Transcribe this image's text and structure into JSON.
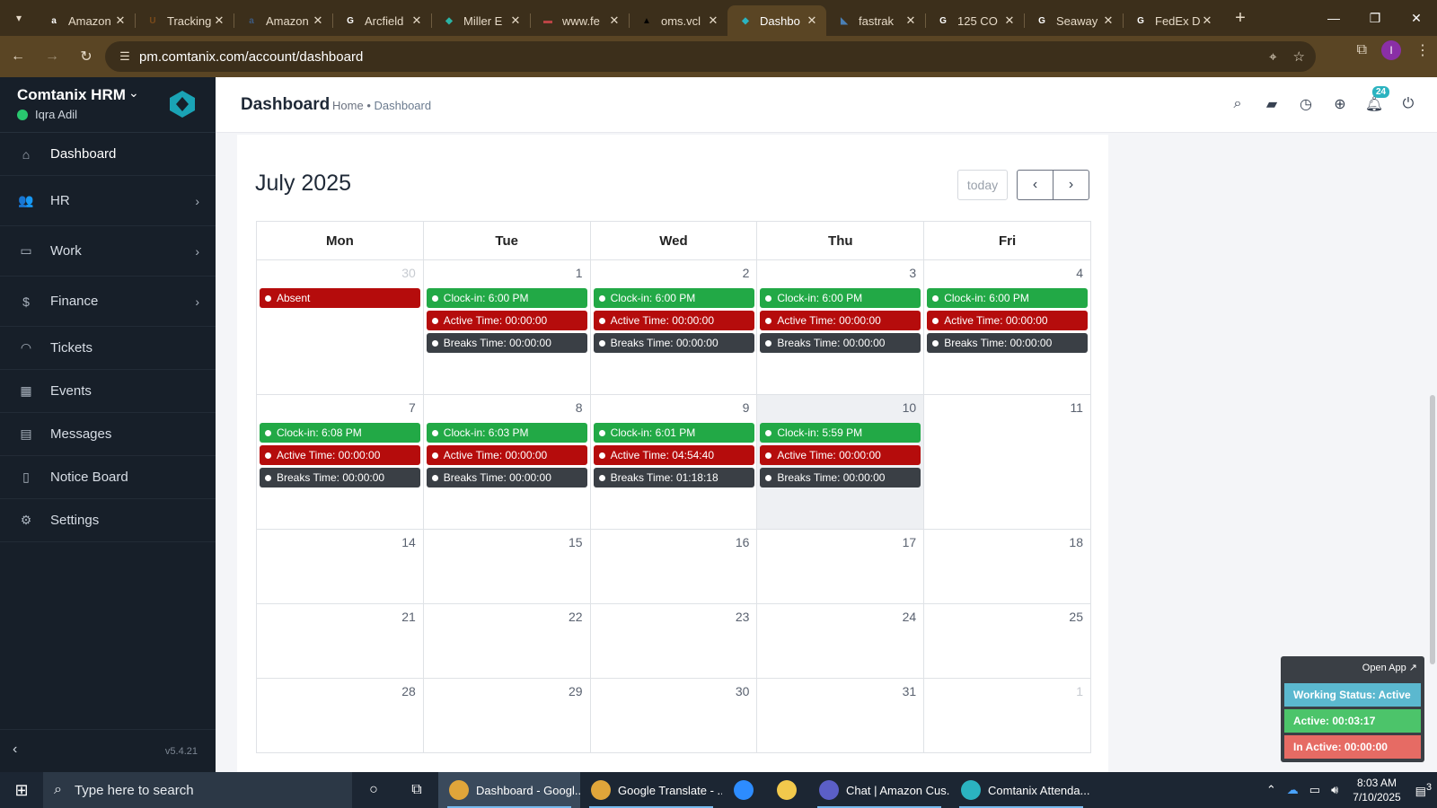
{
  "browser": {
    "tabs": [
      {
        "title": "Amazon",
        "favicon": "amazon-icon",
        "color": "#ffffff",
        "glyph": "a"
      },
      {
        "title": "Tracking",
        "favicon": "ups-icon",
        "color": "#7a4a1a",
        "glyph": "U"
      },
      {
        "title": "Amazon",
        "favicon": "amazon-icon",
        "color": "#3d5a80",
        "glyph": "a"
      },
      {
        "title": "Arcfield",
        "favicon": "google-icon",
        "color": "#ffffff",
        "glyph": "G"
      },
      {
        "title": "Miller E",
        "favicon": "miller-icon",
        "color": "#2bb3a4",
        "glyph": "◆"
      },
      {
        "title": "www.fe",
        "favicon": "flag-icon",
        "color": "#b44",
        "glyph": "▬"
      },
      {
        "title": "oms.vcl",
        "favicon": "oms-icon",
        "color": "#000000",
        "glyph": "▲"
      },
      {
        "title": "Dashbo",
        "favicon": "comtanix-icon",
        "color": "#2bb3c0",
        "glyph": "◆"
      },
      {
        "title": "fastrak",
        "favicon": "fastrak-icon",
        "color": "#4a7fb5",
        "glyph": "◣"
      },
      {
        "title": "125 CO",
        "favicon": "google-icon",
        "color": "#ffffff",
        "glyph": "G"
      },
      {
        "title": "Seaway",
        "favicon": "google-icon",
        "color": "#ffffff",
        "glyph": "G"
      },
      {
        "title": "FedEx D",
        "favicon": "google-icon",
        "color": "#ffffff",
        "glyph": "G"
      }
    ],
    "active_tab": 7,
    "url": "pm.comtanix.com/account/dashboard",
    "profile_initial": "I"
  },
  "sidebar": {
    "brand": "Comtanix HRM",
    "user": "Iqra Adil",
    "items": [
      {
        "label": "Dashboard",
        "icon": "home-icon",
        "glyph": "⌂",
        "arrow": false,
        "active": true
      },
      {
        "label": "HR",
        "icon": "users-icon",
        "glyph": "👥",
        "arrow": true
      },
      {
        "label": "Work",
        "icon": "briefcase-icon",
        "glyph": "▭",
        "arrow": true
      },
      {
        "label": "Finance",
        "icon": "dollar-icon",
        "glyph": "$",
        "arrow": true
      },
      {
        "label": "Tickets",
        "icon": "headset-icon",
        "glyph": "◠",
        "arrow": false
      },
      {
        "label": "Events",
        "icon": "calendar-icon",
        "glyph": "▦",
        "arrow": false
      },
      {
        "label": "Messages",
        "icon": "message-icon",
        "glyph": "▤",
        "arrow": false
      },
      {
        "label": "Notice Board",
        "icon": "clipboard-icon",
        "glyph": "▯",
        "arrow": false
      },
      {
        "label": "Settings",
        "icon": "gear-icon",
        "glyph": "⚙",
        "arrow": false
      }
    ],
    "version": "v5.4.21"
  },
  "header": {
    "title": "Dashboard",
    "breadcrumb_home": "Home",
    "breadcrumb_sep": "•",
    "breadcrumb_current": "Dashboard",
    "notification_count": "24"
  },
  "calendar": {
    "title": "July 2025",
    "today_label": "today",
    "weekdays": [
      "Mon",
      "Tue",
      "Wed",
      "Thu",
      "Fri"
    ],
    "weeks": [
      [
        {
          "day": "30",
          "muted": true,
          "events": [
            {
              "text": "Absent",
              "type": "red"
            }
          ]
        },
        {
          "day": "1",
          "events": [
            {
              "text": "Clock-in: 6:00 PM",
              "type": "green"
            },
            {
              "text": "Active Time: 00:00:00",
              "type": "red"
            },
            {
              "text": "Breaks Time: 00:00:00",
              "type": "dark"
            }
          ]
        },
        {
          "day": "2",
          "events": [
            {
              "text": "Clock-in: 6:00 PM",
              "type": "green"
            },
            {
              "text": "Active Time: 00:00:00",
              "type": "red"
            },
            {
              "text": "Breaks Time: 00:00:00",
              "type": "dark"
            }
          ]
        },
        {
          "day": "3",
          "events": [
            {
              "text": "Clock-in: 6:00 PM",
              "type": "green"
            },
            {
              "text": "Active Time: 00:00:00",
              "type": "red"
            },
            {
              "text": "Breaks Time: 00:00:00",
              "type": "dark"
            }
          ]
        },
        {
          "day": "4",
          "events": [
            {
              "text": "Clock-in: 6:00 PM",
              "type": "green"
            },
            {
              "text": "Active Time: 00:00:00",
              "type": "red"
            },
            {
              "text": "Breaks Time: 00:00:00",
              "type": "dark"
            }
          ]
        }
      ],
      [
        {
          "day": "7",
          "events": [
            {
              "text": "Clock-in: 6:08 PM",
              "type": "green"
            },
            {
              "text": "Active Time: 00:00:00",
              "type": "red"
            },
            {
              "text": "Breaks Time: 00:00:00",
              "type": "dark"
            }
          ]
        },
        {
          "day": "8",
          "events": [
            {
              "text": "Clock-in: 6:03 PM",
              "type": "green"
            },
            {
              "text": "Active Time: 00:00:00",
              "type": "red"
            },
            {
              "text": "Breaks Time: 00:00:00",
              "type": "dark"
            }
          ]
        },
        {
          "day": "9",
          "events": [
            {
              "text": "Clock-in: 6:01 PM",
              "type": "green"
            },
            {
              "text": "Active Time: 04:54:40",
              "type": "red"
            },
            {
              "text": "Breaks Time: 01:18:18",
              "type": "dark"
            }
          ]
        },
        {
          "day": "10",
          "today": true,
          "events": [
            {
              "text": "Clock-in: 5:59 PM",
              "type": "green"
            },
            {
              "text": "Active Time: 00:00:00",
              "type": "red"
            },
            {
              "text": "Breaks Time: 00:00:00",
              "type": "dark"
            }
          ]
        },
        {
          "day": "11",
          "events": []
        }
      ],
      [
        {
          "day": "14",
          "events": []
        },
        {
          "day": "15",
          "events": []
        },
        {
          "day": "16",
          "events": []
        },
        {
          "day": "17",
          "events": []
        },
        {
          "day": "18",
          "events": []
        }
      ],
      [
        {
          "day": "21",
          "events": []
        },
        {
          "day": "22",
          "events": []
        },
        {
          "day": "23",
          "events": []
        },
        {
          "day": "24",
          "events": []
        },
        {
          "day": "25",
          "events": []
        }
      ],
      [
        {
          "day": "28",
          "events": []
        },
        {
          "day": "29",
          "events": []
        },
        {
          "day": "30",
          "events": []
        },
        {
          "day": "31",
          "events": []
        },
        {
          "day": "1",
          "muted": true,
          "events": []
        }
      ]
    ]
  },
  "widget": {
    "open_app": "Open App ↗",
    "working_status": "Working Status: Active",
    "active": "Active: 00:03:17",
    "inactive": "In Active: 00:00:00"
  },
  "taskbar": {
    "search_placeholder": "Type here to search",
    "apps": [
      {
        "label": "Dashboard - Googl...",
        "color": "#e0a53a",
        "active": true
      },
      {
        "label": "Google Translate - ...",
        "color": "#e0a53a",
        "active": false
      },
      {
        "label": "zm",
        "color": "#2d8cff",
        "active": false,
        "icon_only": true
      },
      {
        "label": "files",
        "color": "#f2c94c",
        "active": false,
        "icon_only": true
      },
      {
        "label": "Chat | Amazon Cus...",
        "color": "#5b5fc7",
        "active": false
      },
      {
        "label": "Comtanix Attenda...",
        "color": "#2bb3c0",
        "active": false
      }
    ],
    "time": "8:03 AM",
    "date": "7/10/2025",
    "notification_count": "3"
  }
}
